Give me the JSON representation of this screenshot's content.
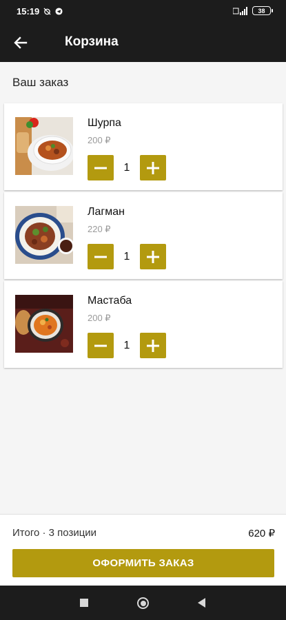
{
  "status_bar": {
    "time": "15:19",
    "battery": "38"
  },
  "app_bar": {
    "title": "Корзина"
  },
  "section": {
    "title": "Ваш заказ"
  },
  "cart": {
    "items": [
      {
        "name": "Шурпа",
        "price": "200 ₽",
        "quantity": "1"
      },
      {
        "name": "Лагман",
        "price": "220 ₽",
        "quantity": "1"
      },
      {
        "name": "Мастаба",
        "price": "200 ₽",
        "quantity": "1"
      }
    ]
  },
  "summary": {
    "label": "Итого · 3 позиции",
    "total": "620 ₽"
  },
  "checkout": {
    "label": "ОФОРМИТЬ ЗАКАЗ"
  },
  "colors": {
    "accent": "#b39a0f",
    "bar": "#1c1c1c",
    "background": "#f5f5f5"
  }
}
